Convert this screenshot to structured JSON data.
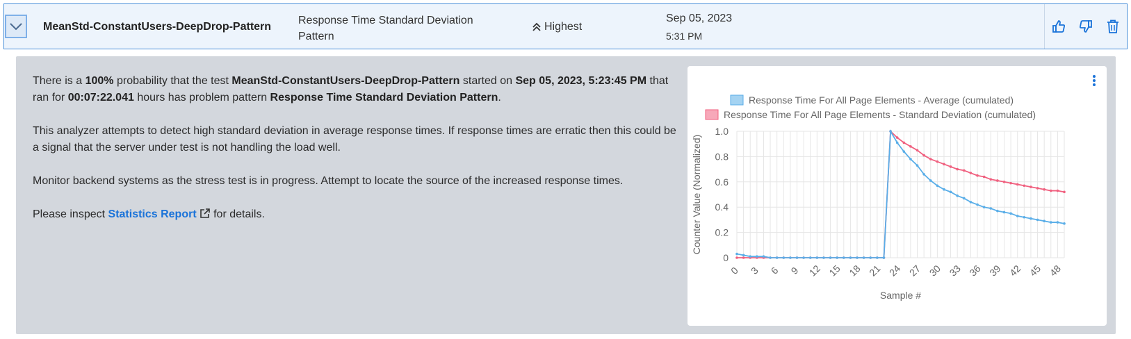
{
  "row": {
    "test_name": "MeanStd-ConstantUsers-DeepDrop-Pattern",
    "pattern_line1": "Response Time Standard Deviation",
    "pattern_line2": "Pattern",
    "priority": "Highest",
    "date": "Sep 05, 2023",
    "time": "5:31 PM"
  },
  "details": {
    "p1": {
      "a": "There is a ",
      "prob": "100%",
      "b": " probability that the test ",
      "test": "MeanStd-ConstantUsers-DeepDrop-Pattern",
      "c": " started on ",
      "started": "Sep 05, 2023, 5:23:45 PM",
      "d": " that ran for ",
      "duration": "00:07:22.041",
      "e": " hours has problem pattern ",
      "pattern": "Response Time Standard Deviation Pattern",
      "f": "."
    },
    "p2": "This analyzer attempts to detect high standard deviation in average response times. If response times are erratic then this could be a signal that the server under test is not handling the load well.",
    "p3": "Monitor backend systems as the stress test is in progress. Attempt to locate the source of the increased response times.",
    "p4": {
      "a": "Please inspect ",
      "link": "Statistics Report",
      "b": " for details."
    }
  },
  "colors": {
    "avg_series": "#5aaee8",
    "std_series": "#f0607f",
    "link": "#1a73d9",
    "accent": "#1a73d9"
  },
  "icons": [
    "chevron-down-icon",
    "double-chevron-up-icon",
    "thumbs-up-icon",
    "thumbs-down-icon",
    "trash-icon",
    "external-link-icon",
    "kebab-menu-icon"
  ],
  "chart_data": {
    "type": "line",
    "xlabel": "Sample #",
    "ylabel": "Counter Value (Normalized)",
    "xlim": [
      0,
      49
    ],
    "ylim": [
      0,
      1.0
    ],
    "x_ticks": [
      0,
      3,
      6,
      9,
      12,
      15,
      18,
      21,
      24,
      27,
      30,
      33,
      36,
      39,
      42,
      45,
      48
    ],
    "y_ticks": [
      0,
      0.2,
      0.4,
      0.6,
      0.8,
      1.0
    ],
    "grid": true,
    "legend_position": "top",
    "series": [
      {
        "name": "Response Time For All Page Elements - Average (cumulated)",
        "color": "#5aaee8",
        "x": [
          0,
          1,
          2,
          3,
          4,
          5,
          6,
          7,
          8,
          9,
          10,
          11,
          12,
          13,
          14,
          15,
          16,
          17,
          18,
          19,
          20,
          21,
          22,
          23,
          24,
          25,
          26,
          27,
          28,
          29,
          30,
          31,
          32,
          33,
          34,
          35,
          36,
          37,
          38,
          39,
          40,
          41,
          42,
          43,
          44,
          45,
          46,
          47,
          48,
          49
        ],
        "values": [
          0.03,
          0.02,
          0.01,
          0.01,
          0.01,
          0,
          0,
          0,
          0,
          0,
          0,
          0,
          0,
          0,
          0,
          0,
          0,
          0,
          0,
          0,
          0,
          0,
          0,
          1.0,
          0.91,
          0.84,
          0.78,
          0.73,
          0.66,
          0.61,
          0.57,
          0.54,
          0.52,
          0.49,
          0.47,
          0.44,
          0.42,
          0.4,
          0.39,
          0.37,
          0.36,
          0.35,
          0.33,
          0.32,
          0.31,
          0.3,
          0.29,
          0.28,
          0.28,
          0.27
        ]
      },
      {
        "name": "Response Time For All Page Elements - Standard Deviation (cumulated)",
        "color": "#f0607f",
        "x": [
          0,
          1,
          2,
          3,
          4,
          5,
          6,
          7,
          8,
          9,
          10,
          11,
          12,
          13,
          14,
          15,
          16,
          17,
          18,
          19,
          20,
          21,
          22,
          23,
          24,
          25,
          26,
          27,
          28,
          29,
          30,
          31,
          32,
          33,
          34,
          35,
          36,
          37,
          38,
          39,
          40,
          41,
          42,
          43,
          44,
          45,
          46,
          47,
          48,
          49
        ],
        "values": [
          0,
          0,
          0,
          0,
          0,
          0,
          0,
          0,
          0,
          0,
          0,
          0,
          0,
          0,
          0,
          0,
          0,
          0,
          0,
          0,
          0,
          0,
          0,
          1.0,
          0.95,
          0.91,
          0.88,
          0.85,
          0.81,
          0.78,
          0.76,
          0.74,
          0.72,
          0.7,
          0.69,
          0.67,
          0.65,
          0.64,
          0.62,
          0.61,
          0.6,
          0.59,
          0.58,
          0.57,
          0.56,
          0.55,
          0.54,
          0.53,
          0.53,
          0.52
        ]
      }
    ]
  }
}
